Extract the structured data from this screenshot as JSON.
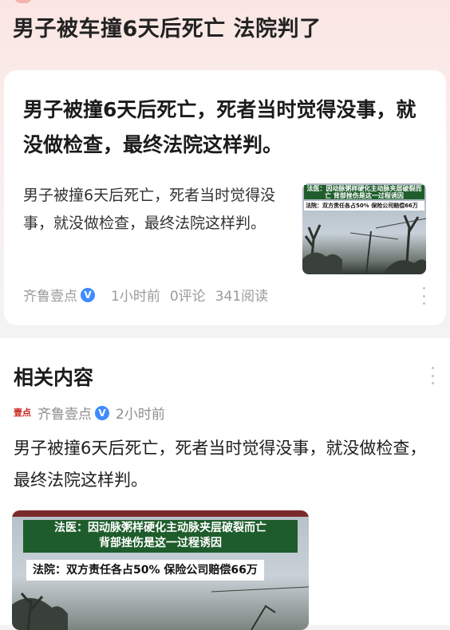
{
  "page": {
    "title": "男子被车撞6天后死亡 法院判了"
  },
  "article": {
    "headline": "男子被撞6天后死亡，死者当时觉得没事，就没做检查，最终法院这样判。",
    "summary": "男子被撞6天后死亡，死者当时觉得没事，就没做检查，最终法院这样判。",
    "thumbnail": {
      "caption_line1": "法医：因动脉粥样硬化主动脉夹层破裂而亡 背部挫伤是这一过程诱因",
      "caption_line2": "法院：双方责任各占50% 保险公司赔偿66万"
    },
    "meta": {
      "source": "齐鲁壹点",
      "verified_badge": "V",
      "time": "1小时前",
      "comments": "0评论",
      "reads": "341阅读"
    }
  },
  "related": {
    "title": "相关内容",
    "item": {
      "logo_text": "壹点",
      "source": "齐鲁壹点",
      "verified_badge": "V",
      "time": "2小时前",
      "text": "男子被撞6天后死亡，死者当时觉得没事，就没做检查，最终法院这样判。",
      "image": {
        "caption_line1": "法医：因动脉粥样硬化主动脉夹层破裂而亡",
        "caption_line1b": "背部挫伤是这一过程诱因",
        "caption_line2": "法院：双方责任各占50% 保险公司赔偿66万"
      }
    }
  },
  "colors": {
    "accent_verified": "#3f8bff",
    "caption_green": "#1e5c2c",
    "header_tint": "#fbe6e3"
  },
  "icons": [
    "verified-badge-icon",
    "more-options-icon",
    "source-logo-icon"
  ]
}
